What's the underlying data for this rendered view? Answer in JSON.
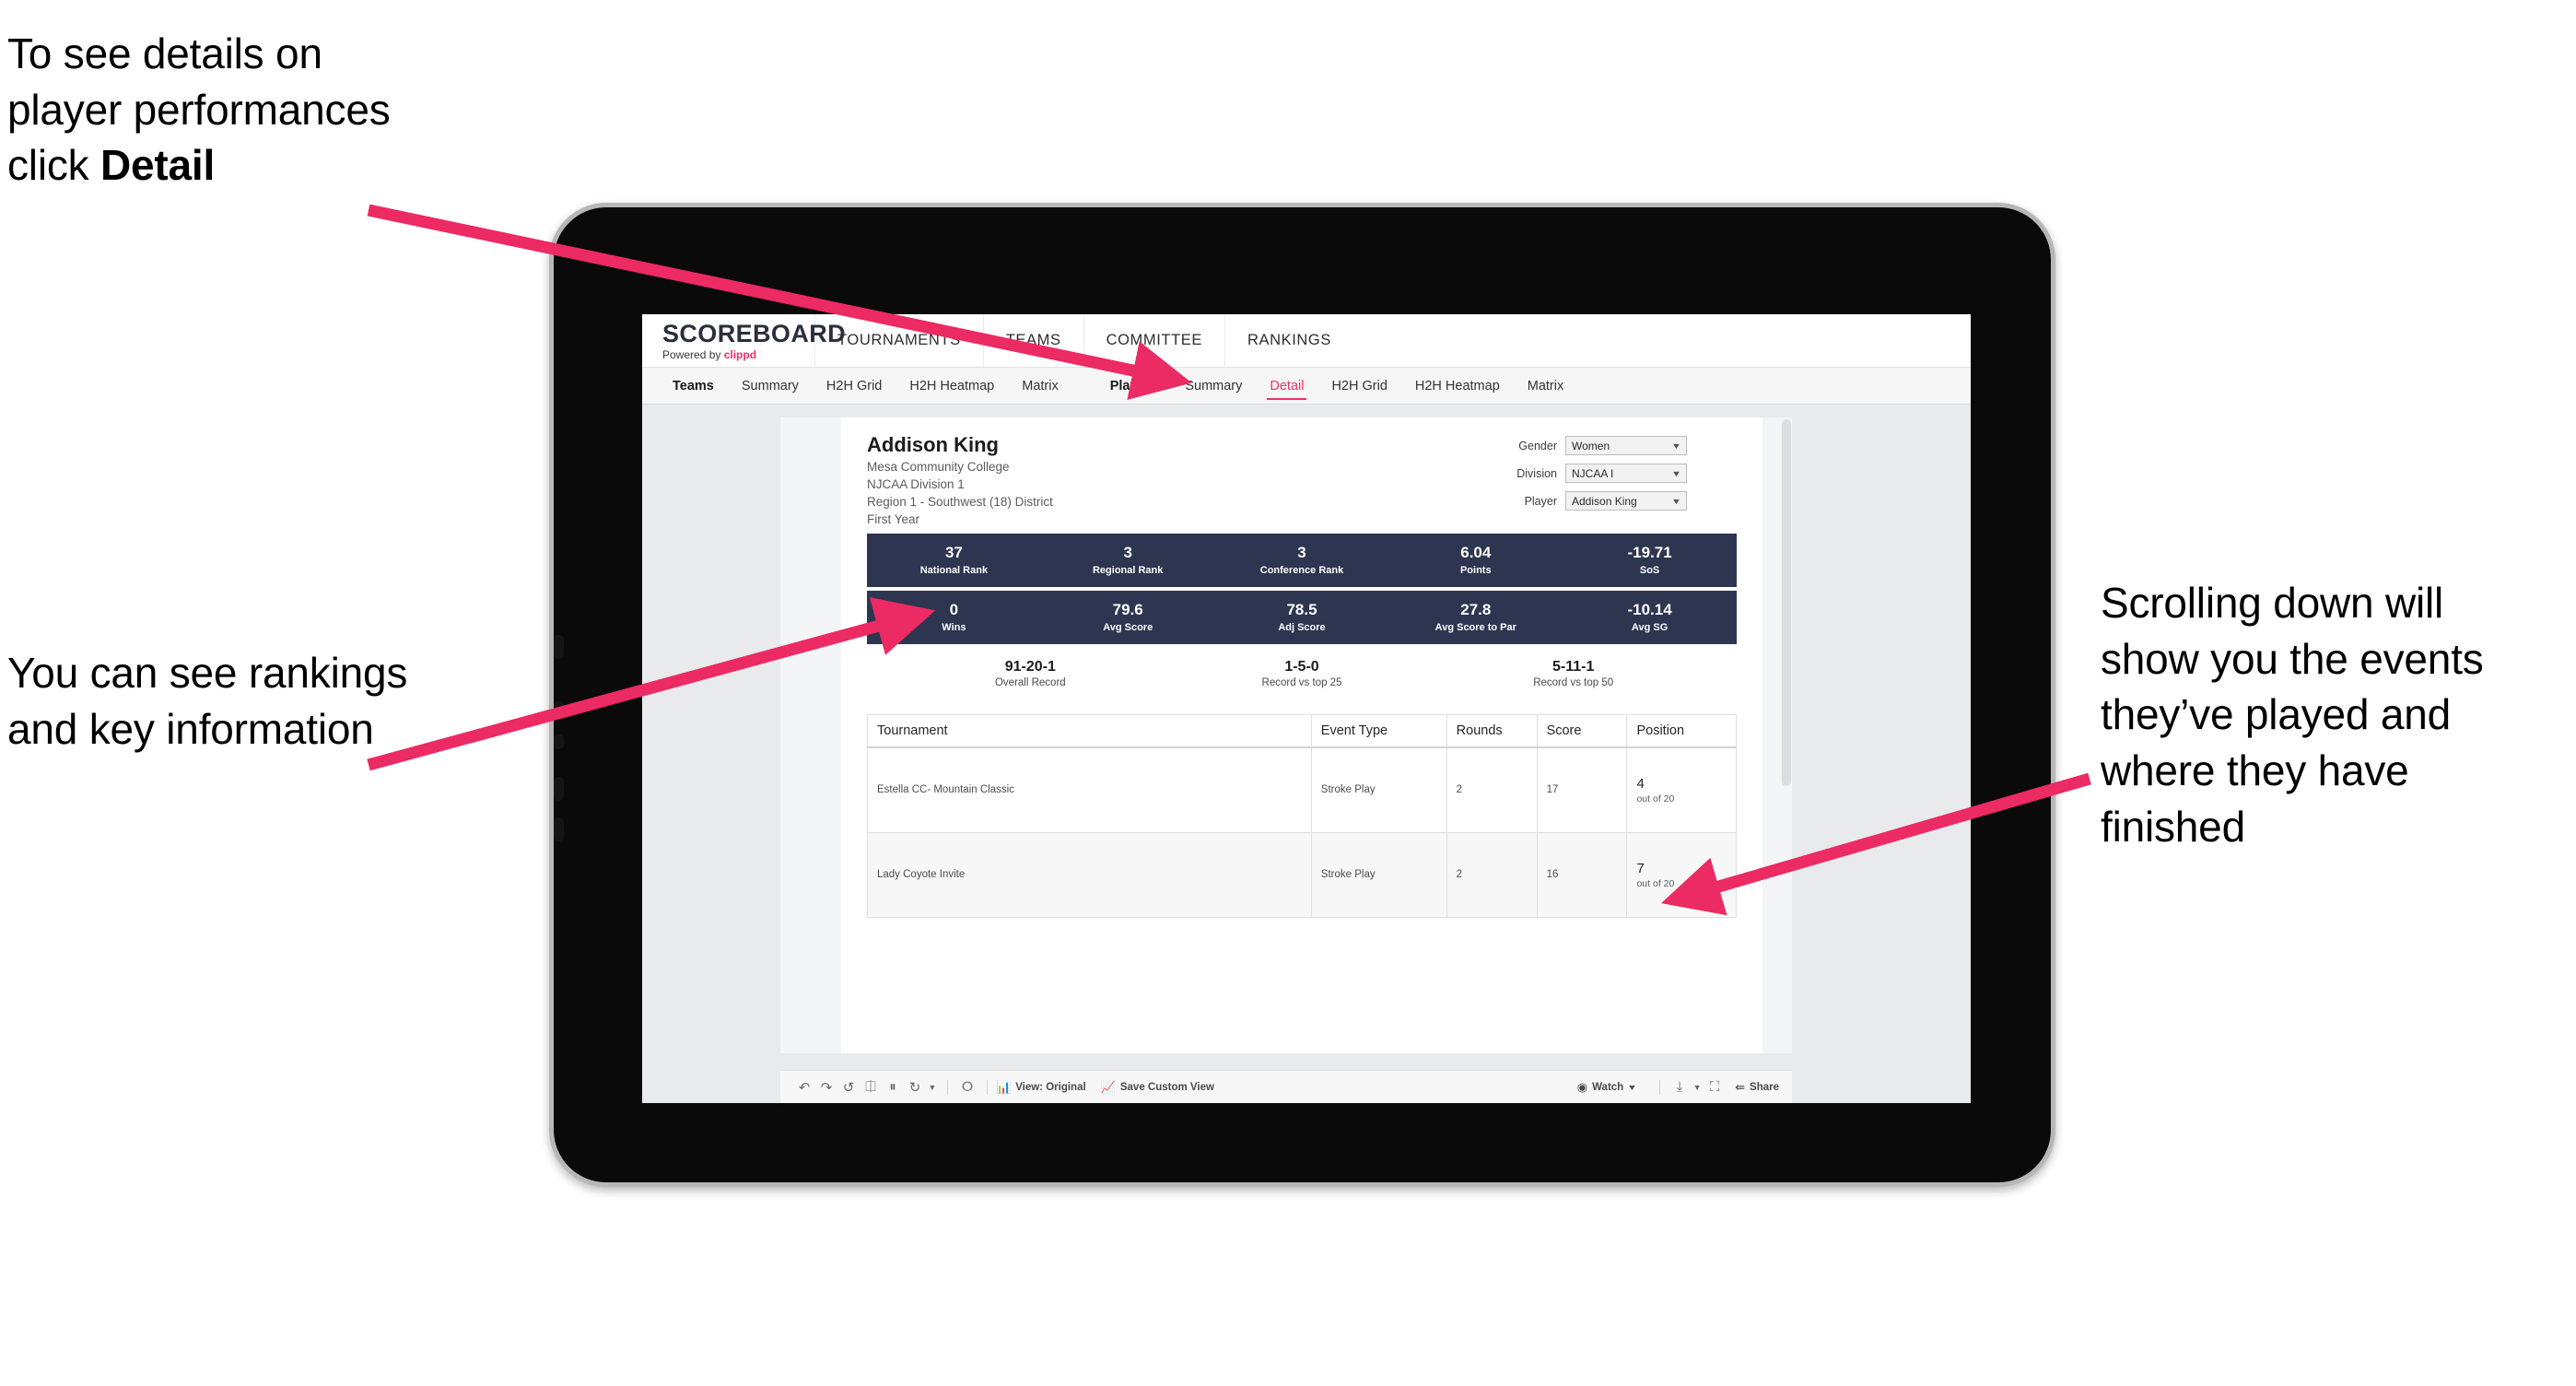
{
  "annotations": {
    "detail_note_line1": "To see details on",
    "detail_note_line2": "player performances",
    "detail_note_line3_prefix": "click ",
    "detail_note_line3_bold": "Detail",
    "rankings_note": "You can see rankings and key information",
    "scroll_note": "Scrolling down will show you the events they’ve played and where they have finished"
  },
  "app": {
    "logo_word": "SCOREBOARD",
    "logo_sub_prefix": "Powered by ",
    "logo_brand": "clippd",
    "main_nav": [
      "TOURNAMENTS",
      "TEAMS",
      "COMMITTEE",
      "RANKINGS"
    ],
    "sub_nav": {
      "teams_group": "Teams",
      "teams_items": [
        "Summary",
        "H2H Grid",
        "H2H Heatmap",
        "Matrix"
      ],
      "players_group": "Players",
      "players_items": [
        "Summary",
        "Detail",
        "H2H Grid",
        "H2H Heatmap",
        "Matrix"
      ],
      "active_tab": "Detail"
    }
  },
  "player": {
    "name": "Addison King",
    "school": "Mesa Community College",
    "division": "NJCAA Division 1",
    "region": "Region 1 - Southwest (18) District",
    "year": "First Year"
  },
  "filters": [
    {
      "label": "Gender",
      "value": "Women"
    },
    {
      "label": "Division",
      "value": "NJCAA I"
    },
    {
      "label": "Player",
      "value": "Addison King"
    }
  ],
  "stats_band_1": [
    {
      "value": "37",
      "label": "National Rank"
    },
    {
      "value": "3",
      "label": "Regional Rank"
    },
    {
      "value": "3",
      "label": "Conference Rank"
    },
    {
      "value": "6.04",
      "label": "Points"
    },
    {
      "value": "-19.71",
      "label": "SoS"
    }
  ],
  "stats_band_2": [
    {
      "value": "0",
      "label": "Wins"
    },
    {
      "value": "79.6",
      "label": "Avg Score"
    },
    {
      "value": "78.5",
      "label": "Adj Score"
    },
    {
      "value": "27.8",
      "label": "Avg Score to Par"
    },
    {
      "value": "-10.14",
      "label": "Avg SG"
    }
  ],
  "records": [
    {
      "value": "91-20-1",
      "label": "Overall Record"
    },
    {
      "value": "1-5-0",
      "label": "Record vs top 25"
    },
    {
      "value": "5-11-1",
      "label": "Record vs top 50"
    }
  ],
  "events_table": {
    "headers": [
      "Tournament",
      "Event Type",
      "Rounds",
      "Score",
      "Position"
    ],
    "rows": [
      {
        "tournament": "Estella CC- Mountain Classic",
        "event_type": "Stroke Play",
        "rounds": "2",
        "score": "17",
        "position": "4",
        "position_sub": "out of 20"
      },
      {
        "tournament": "Lady Coyote Invite",
        "event_type": "Stroke Play",
        "rounds": "2",
        "score": "16",
        "position": "7",
        "position_sub": "out of 20"
      }
    ]
  },
  "toolbar": {
    "view_label": "View: Original",
    "save_label": "Save Custom View",
    "watch_label": "Watch",
    "share_label": "Share"
  },
  "colors": {
    "accent_pink": "#f0306a",
    "band_navy": "#2e3550",
    "arrow_pink": "#ec2a63"
  }
}
